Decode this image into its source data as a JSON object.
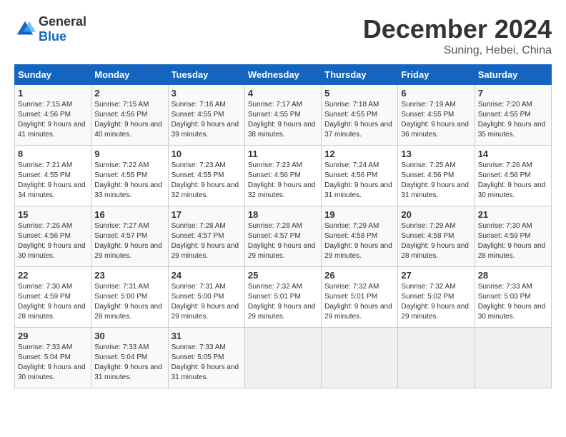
{
  "logo": {
    "general": "General",
    "blue": "Blue"
  },
  "header": {
    "month": "December 2024",
    "location": "Suning, Hebei, China"
  },
  "weekdays": [
    "Sunday",
    "Monday",
    "Tuesday",
    "Wednesday",
    "Thursday",
    "Friday",
    "Saturday"
  ],
  "weeks": [
    [
      {
        "day": "1",
        "sunrise": "7:15 AM",
        "sunset": "4:56 PM",
        "daylight": "9 hours and 41 minutes."
      },
      {
        "day": "2",
        "sunrise": "7:15 AM",
        "sunset": "4:56 PM",
        "daylight": "9 hours and 40 minutes."
      },
      {
        "day": "3",
        "sunrise": "7:16 AM",
        "sunset": "4:55 PM",
        "daylight": "9 hours and 39 minutes."
      },
      {
        "day": "4",
        "sunrise": "7:17 AM",
        "sunset": "4:55 PM",
        "daylight": "9 hours and 38 minutes."
      },
      {
        "day": "5",
        "sunrise": "7:18 AM",
        "sunset": "4:55 PM",
        "daylight": "9 hours and 37 minutes."
      },
      {
        "day": "6",
        "sunrise": "7:19 AM",
        "sunset": "4:55 PM",
        "daylight": "9 hours and 36 minutes."
      },
      {
        "day": "7",
        "sunrise": "7:20 AM",
        "sunset": "4:55 PM",
        "daylight": "9 hours and 35 minutes."
      }
    ],
    [
      {
        "day": "8",
        "sunrise": "7:21 AM",
        "sunset": "4:55 PM",
        "daylight": "9 hours and 34 minutes."
      },
      {
        "day": "9",
        "sunrise": "7:22 AM",
        "sunset": "4:55 PM",
        "daylight": "9 hours and 33 minutes."
      },
      {
        "day": "10",
        "sunrise": "7:23 AM",
        "sunset": "4:55 PM",
        "daylight": "9 hours and 32 minutes."
      },
      {
        "day": "11",
        "sunrise": "7:23 AM",
        "sunset": "4:56 PM",
        "daylight": "9 hours and 32 minutes."
      },
      {
        "day": "12",
        "sunrise": "7:24 AM",
        "sunset": "4:56 PM",
        "daylight": "9 hours and 31 minutes."
      },
      {
        "day": "13",
        "sunrise": "7:25 AM",
        "sunset": "4:56 PM",
        "daylight": "9 hours and 31 minutes."
      },
      {
        "day": "14",
        "sunrise": "7:26 AM",
        "sunset": "4:56 PM",
        "daylight": "9 hours and 30 minutes."
      }
    ],
    [
      {
        "day": "15",
        "sunrise": "7:26 AM",
        "sunset": "4:56 PM",
        "daylight": "9 hours and 30 minutes."
      },
      {
        "day": "16",
        "sunrise": "7:27 AM",
        "sunset": "4:57 PM",
        "daylight": "9 hours and 29 minutes."
      },
      {
        "day": "17",
        "sunrise": "7:28 AM",
        "sunset": "4:57 PM",
        "daylight": "9 hours and 29 minutes."
      },
      {
        "day": "18",
        "sunrise": "7:28 AM",
        "sunset": "4:57 PM",
        "daylight": "9 hours and 29 minutes."
      },
      {
        "day": "19",
        "sunrise": "7:29 AM",
        "sunset": "4:58 PM",
        "daylight": "9 hours and 29 minutes."
      },
      {
        "day": "20",
        "sunrise": "7:29 AM",
        "sunset": "4:58 PM",
        "daylight": "9 hours and 28 minutes."
      },
      {
        "day": "21",
        "sunrise": "7:30 AM",
        "sunset": "4:59 PM",
        "daylight": "9 hours and 28 minutes."
      }
    ],
    [
      {
        "day": "22",
        "sunrise": "7:30 AM",
        "sunset": "4:59 PM",
        "daylight": "9 hours and 28 minutes."
      },
      {
        "day": "23",
        "sunrise": "7:31 AM",
        "sunset": "5:00 PM",
        "daylight": "9 hours and 28 minutes."
      },
      {
        "day": "24",
        "sunrise": "7:31 AM",
        "sunset": "5:00 PM",
        "daylight": "9 hours and 29 minutes."
      },
      {
        "day": "25",
        "sunrise": "7:32 AM",
        "sunset": "5:01 PM",
        "daylight": "9 hours and 29 minutes."
      },
      {
        "day": "26",
        "sunrise": "7:32 AM",
        "sunset": "5:01 PM",
        "daylight": "9 hours and 29 minutes."
      },
      {
        "day": "27",
        "sunrise": "7:32 AM",
        "sunset": "5:02 PM",
        "daylight": "9 hours and 29 minutes."
      },
      {
        "day": "28",
        "sunrise": "7:33 AM",
        "sunset": "5:03 PM",
        "daylight": "9 hours and 30 minutes."
      }
    ],
    [
      {
        "day": "29",
        "sunrise": "7:33 AM",
        "sunset": "5:04 PM",
        "daylight": "9 hours and 30 minutes."
      },
      {
        "day": "30",
        "sunrise": "7:33 AM",
        "sunset": "5:04 PM",
        "daylight": "9 hours and 31 minutes."
      },
      {
        "day": "31",
        "sunrise": "7:33 AM",
        "sunset": "5:05 PM",
        "daylight": "9 hours and 31 minutes."
      },
      null,
      null,
      null,
      null
    ]
  ]
}
